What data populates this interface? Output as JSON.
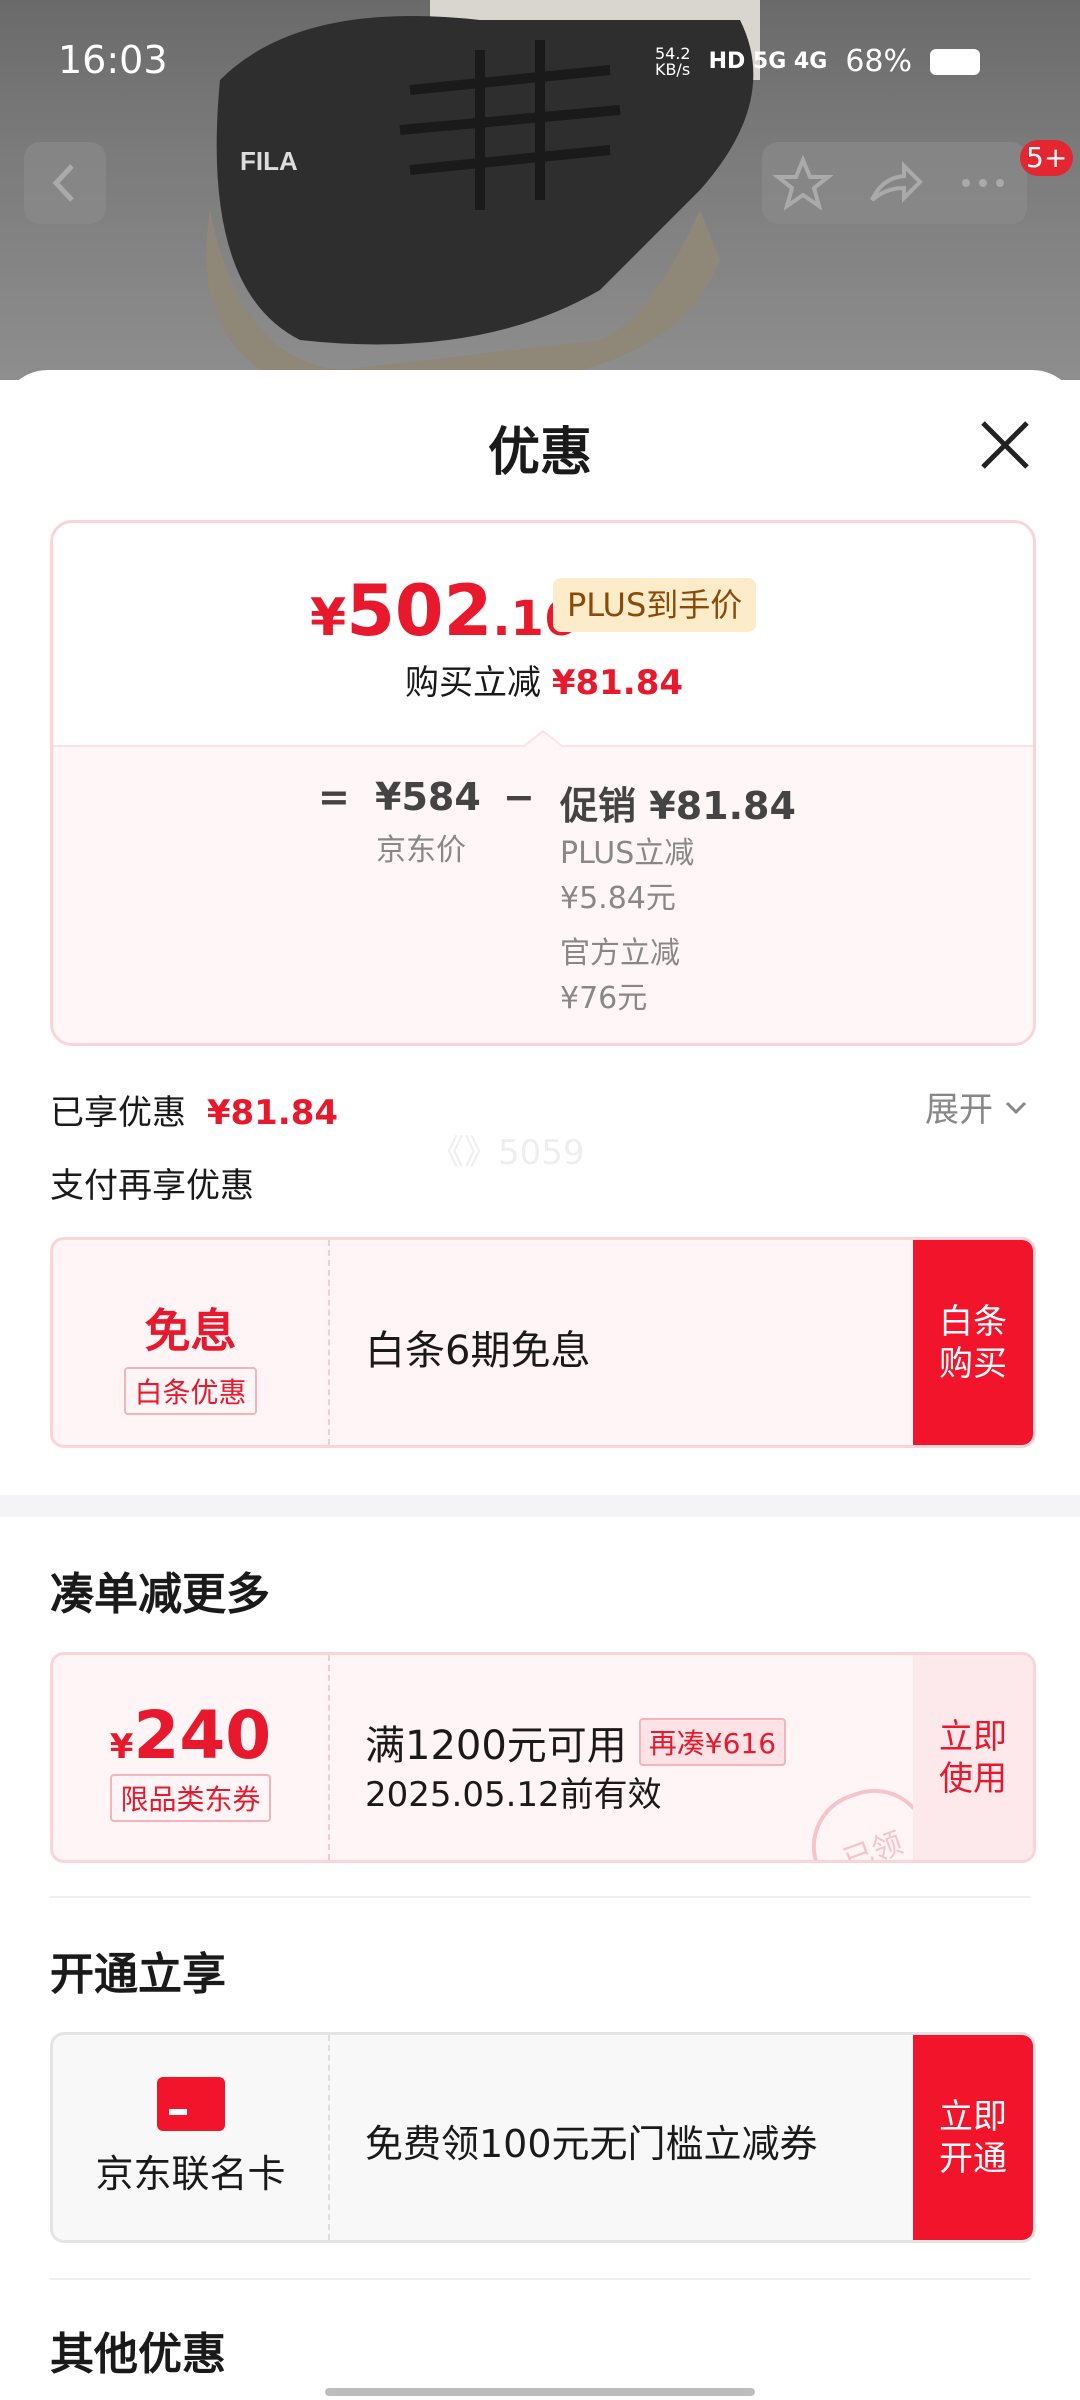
{
  "status_bar": {
    "time": "16:03",
    "net_speed": "54.2\nKB/s",
    "signal_labels": "HD 5G 4G",
    "battery": "68%"
  },
  "top_nav": {
    "badge": "5+"
  },
  "sheet": {
    "title": "优惠"
  },
  "price_summary": {
    "currency": "¥",
    "main_int": "502",
    "main_dec": ".16",
    "plus_tag": "PLUS到手价",
    "reduce_label": "购买立减",
    "reduce_value": "¥81.84",
    "breakdown": {
      "equals": "=",
      "jd_price": "¥584",
      "jd_price_label": "京东价",
      "minus": "−",
      "promo_label": "促销",
      "promo_value": "¥81.84",
      "plus_reduce_label": "PLUS立减",
      "plus_reduce_value": "¥5.84元",
      "official_reduce_label": "官方立减",
      "official_reduce_value": "¥76元"
    }
  },
  "enjoyed": {
    "label": "已享优惠",
    "value": "¥81.84",
    "expand": "展开"
  },
  "pay_more": {
    "label": "支付再享优惠"
  },
  "baitiao": {
    "left_title": "免息",
    "left_tag": "白条优惠",
    "desc": "白条6期免息",
    "button": "白条\n购买"
  },
  "watermark": "《》5059",
  "combine": {
    "heading": "凑单减更多",
    "coupon_currency": "¥",
    "coupon_amount": "240",
    "coupon_tag": "限品类东券",
    "condition": "满1200元可用",
    "gap_tag": "再凑¥616",
    "expiry": "2025.05.12前有效",
    "stamp": "已领",
    "button": "立即\n使用"
  },
  "open": {
    "heading": "开通立享",
    "card_name": "京东联名卡",
    "desc": "免费领100元无门槛立减券",
    "button": "立即\n开通"
  },
  "other": {
    "heading": "其他优惠"
  },
  "colors": {
    "accent": "#e8192c",
    "button_red": "#f2142b",
    "plus_tag_bg": "#fdecc9"
  }
}
